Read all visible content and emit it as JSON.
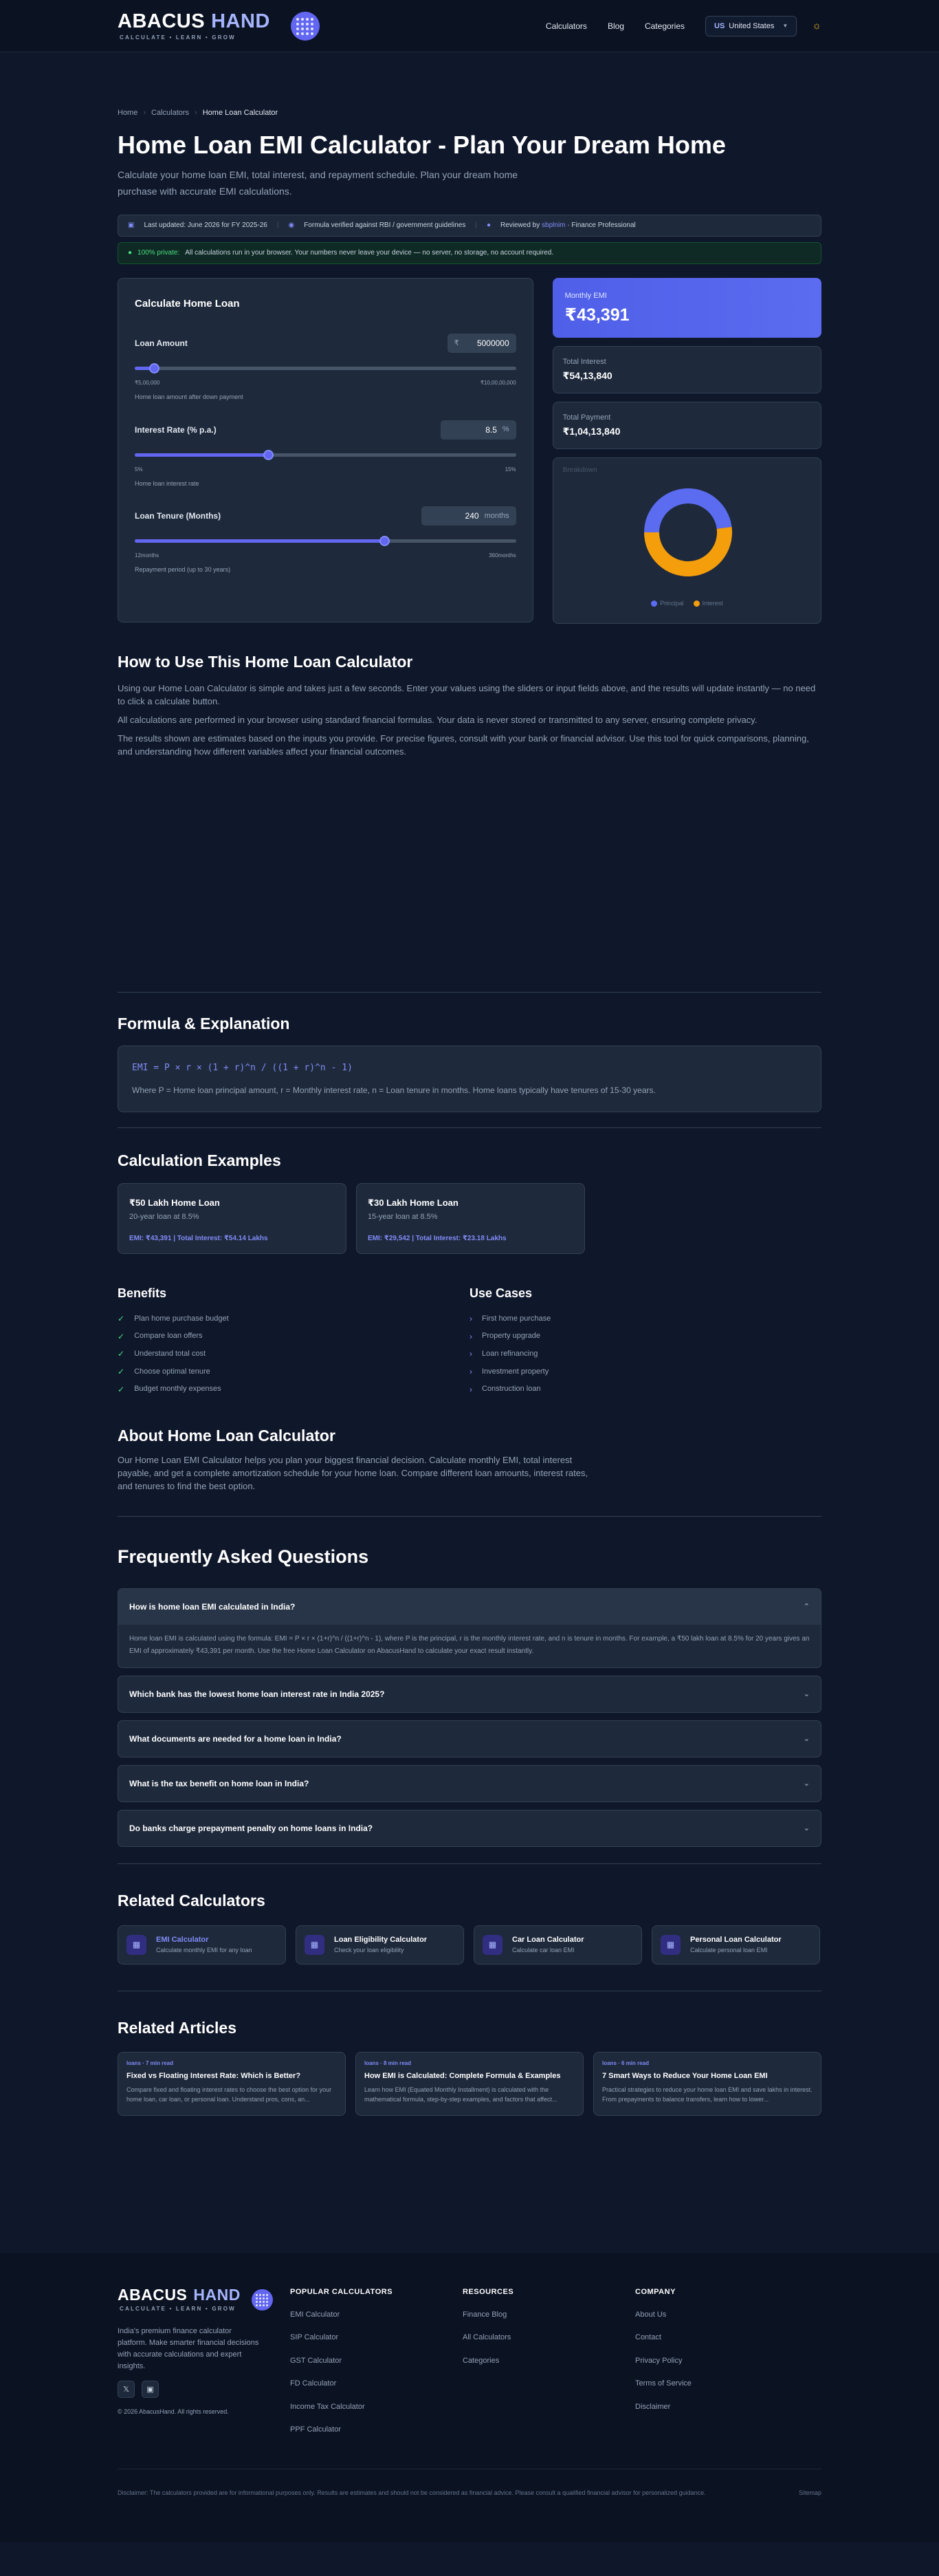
{
  "header": {
    "logo_main": "ABACUS",
    "logo_accent": "HAND",
    "tagline": "CALCULATE • LEARN • GROW",
    "nav": [
      "Calculators",
      "Blog",
      "Categories"
    ],
    "country_code": "US",
    "country_name": "United States"
  },
  "breadcrumb": [
    "Home",
    "Calculators",
    "Home Loan Calculator"
  ],
  "page": {
    "title": "Home Loan EMI Calculator - Plan Your Dream Home",
    "lead": "Calculate your home loan EMI, total interest, and repayment schedule. Plan your dream home purchase with accurate EMI calculations.",
    "meta_updated": "Last updated: June 2026 for FY 2025-26",
    "meta_verified": "Formula verified against RBI / government guidelines",
    "meta_reviewed_prefix": "Reviewed by",
    "meta_reviewer": "sbplnim",
    "meta_role": "· Finance Professional",
    "privacy_label": "100% private:",
    "privacy_text": "All calculations run in your browser. Your numbers never leave your device — no server, no storage, no account required."
  },
  "calculator": {
    "heading": "Calculate Home Loan",
    "loan": {
      "label": "Loan Amount",
      "prefix": "₹",
      "value": "5000000",
      "min": "₹5,00,000",
      "max": "₹10,00,00,000",
      "hint": "Home loan amount after down payment",
      "fill": 0.05
    },
    "rate": {
      "label": "Interest Rate (% p.a.)",
      "value": "8.5",
      "unit": "%",
      "min": "5%",
      "max": "15%",
      "hint": "Home loan interest rate",
      "fill": 0.35
    },
    "tenure": {
      "label": "Loan Tenure (Months)",
      "value": "240",
      "unit": "months",
      "min": "12months",
      "max": "360months",
      "hint": "Repayment period (up to 30 years)",
      "fill": 0.655
    }
  },
  "results": {
    "emi_label": "Monthly EMI",
    "emi_value": "₹43,391",
    "interest_label": "Total Interest",
    "interest_value": "₹54,13,840",
    "payment_label": "Total Payment",
    "payment_value": "₹1,04,13,840",
    "chart_title": "Breakdown",
    "legend_principal": "Principal",
    "legend_interest": "Interest"
  },
  "colors": {
    "principal": "#5b6cf0",
    "interest": "#f59e0b",
    "accent": "#6366f1"
  },
  "chart_data": {
    "type": "pie",
    "categories": [
      "Principal",
      "Interest"
    ],
    "values": [
      5000000,
      5413840
    ]
  },
  "how_to": {
    "heading": "How to Use This Home Loan Calculator",
    "p1": "Using our Home Loan Calculator is simple and takes just a few seconds. Enter your values using the sliders or input fields above, and the results will update instantly — no need to click a calculate button.",
    "p2": "All calculations are performed in your browser using standard financial formulas. Your data is never stored or transmitted to any server, ensuring complete privacy.",
    "p3": "The results shown are estimates based on the inputs you provide. For precise figures, consult with your bank or financial advisor. Use this tool for quick comparisons, planning, and understanding how different variables affect your financial outcomes."
  },
  "formula": {
    "heading": "Formula & Explanation",
    "expr": "EMI = P × r × (1 + r)^n / ((1 + r)^n - 1)",
    "desc": "Where P = Home loan principal amount, r = Monthly interest rate, n = Loan tenure in months. Home loans typically have tenures of 15-30 years."
  },
  "examples": {
    "heading": "Calculation Examples",
    "items": [
      {
        "title": "₹50 Lakh Home Loan",
        "sub": "20-year loan at 8.5%",
        "result": "EMI: ₹43,391 | Total Interest: ₹54.14 Lakhs"
      },
      {
        "title": "₹30 Lakh Home Loan",
        "sub": "15-year loan at 8.5%",
        "result": "EMI: ₹29,542 | Total Interest: ₹23.18 Lakhs"
      }
    ]
  },
  "benefits": {
    "heading": "Benefits",
    "items": [
      "Plan home purchase budget",
      "Compare loan offers",
      "Understand total cost",
      "Choose optimal tenure",
      "Budget monthly expenses"
    ]
  },
  "use_cases": {
    "heading": "Use Cases",
    "items": [
      "First home purchase",
      "Property upgrade",
      "Loan refinancing",
      "Investment property",
      "Construction loan"
    ]
  },
  "about": {
    "heading": "About Home Loan Calculator",
    "text": "Our Home Loan EMI Calculator helps you plan your biggest financial decision. Calculate monthly EMI, total interest payable, and get a complete amortization schedule for your home loan. Compare different loan amounts, interest rates, and tenures to find the best option."
  },
  "faq": {
    "heading": "Frequently Asked Questions",
    "items": [
      {
        "q": "How is home loan EMI calculated in India?",
        "a": "Home loan EMI is calculated using the formula: EMI = P × r × (1+r)^n / ((1+r)^n - 1), where P is the principal, r is the monthly interest rate, and n is tenure in months. For example, a ₹50 lakh loan at 8.5% for 20 years gives an EMI of approximately ₹43,391 per month. Use the free Home Loan Calculator on AbacusHand to calculate your exact result instantly."
      },
      {
        "q": "Which bank has the lowest home loan interest rate in India 2025?"
      },
      {
        "q": "What documents are needed for a home loan in India?"
      },
      {
        "q": "What is the tax benefit on home loan in India?"
      },
      {
        "q": "Do banks charge prepayment penalty on home loans in India?"
      }
    ]
  },
  "related_calculators": {
    "heading": "Related Calculators",
    "items": [
      {
        "title": "EMI Calculator",
        "sub": "Calculate monthly EMI for any loan"
      },
      {
        "title": "Loan Eligibility Calculator",
        "sub": "Check your loan eligibility"
      },
      {
        "title": "Car Loan Calculator",
        "sub": "Calculate car loan EMI"
      },
      {
        "title": "Personal Loan Calculator",
        "sub": "Calculate personal loan EMI"
      }
    ]
  },
  "related_articles": {
    "heading": "Related Articles",
    "items": [
      {
        "tag": "loans · 7 min read",
        "title": "Fixed vs Floating Interest Rate: Which is Better?",
        "sub": "Compare fixed and floating interest rates to choose the best option for your home loan, car loan, or personal loan. Understand pros, cons, an..."
      },
      {
        "tag": "loans · 8 min read",
        "title": "How EMI is Calculated: Complete Formula & Examples",
        "sub": "Learn how EMI (Equated Monthly Installment) is calculated with the mathematical formula, step-by-step examples, and factors that affect..."
      },
      {
        "tag": "loans · 6 min read",
        "title": "7 Smart Ways to Reduce Your Home Loan EMI",
        "sub": "Practical strategies to reduce your home loan EMI and save lakhs in interest. From prepayments to balance transfers, learn how to lower..."
      }
    ]
  },
  "footer": {
    "desc": "India's premium finance calculator platform. Make smarter financial decisions with accurate calculations and expert insights.",
    "copyright": "© 2026 AbacusHand. All rights reserved.",
    "col1_title": "POPULAR CALCULATORS",
    "col1": [
      "EMI Calculator",
      "SIP Calculator",
      "GST Calculator",
      "FD Calculator",
      "Income Tax Calculator",
      "PPF Calculator"
    ],
    "col2_title": "RESOURCES",
    "col2": [
      "Finance Blog",
      "All Calculators",
      "Categories"
    ],
    "col3_title": "COMPANY",
    "col3": [
      "About Us",
      "Contact",
      "Privacy Policy",
      "Terms of Service",
      "Disclaimer"
    ],
    "disclaimer": "Disclaimer: The calculators provided are for informational purposes only. Results are estimates and should not be considered as financial advice. Please consult a qualified financial advisor for personalized guidance.",
    "sitemap": "Sitemap"
  }
}
